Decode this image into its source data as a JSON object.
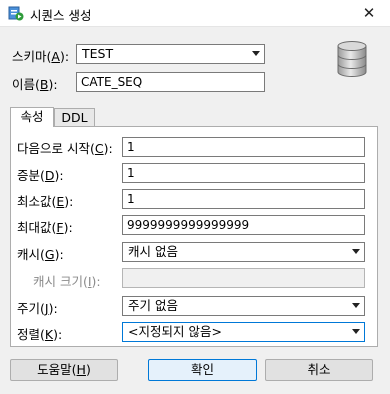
{
  "window": {
    "title": "시퀀스 생성",
    "close_glyph": "✕",
    "icon": "sequence-app-icon"
  },
  "schema": {
    "label": "스키마(",
    "mnemonic": "A",
    "suffix": "):",
    "value": "TEST"
  },
  "name": {
    "label": "이름(",
    "mnemonic": "B",
    "suffix": "):",
    "value": "CATE_SEQ"
  },
  "tabs": [
    {
      "label": "속성",
      "active": true
    },
    {
      "label": "DDL",
      "active": false
    }
  ],
  "properties": {
    "start_with": {
      "label": "다음으로 시작(",
      "mnemonic": "C",
      "suffix": "):",
      "value": "1"
    },
    "increment": {
      "label": "증분(",
      "mnemonic": "D",
      "suffix": "):",
      "value": "1"
    },
    "min_value": {
      "label": "최소값(",
      "mnemonic": "E",
      "suffix": "):",
      "value": "1"
    },
    "max_value": {
      "label": "최대값(",
      "mnemonic": "F",
      "suffix": "):",
      "value": "9999999999999999"
    },
    "cache": {
      "label": "캐시(",
      "mnemonic": "G",
      "suffix": "):",
      "value": "캐시 없음"
    },
    "cache_size": {
      "label": "캐시 크기(",
      "mnemonic": "I",
      "suffix": "):",
      "value": ""
    },
    "cycle": {
      "label": "주기(",
      "mnemonic": "J",
      "suffix": "):",
      "value": "주기 없음"
    },
    "order": {
      "label": "정렬(",
      "mnemonic": "K",
      "suffix": "):",
      "value": "<지정되지 않음>"
    }
  },
  "buttons": {
    "help": {
      "label": "도움말(",
      "mnemonic": "H",
      "suffix": ")"
    },
    "ok": {
      "label": "확인"
    },
    "cancel": {
      "label": "취소"
    }
  },
  "colors": {
    "focus_border": "#0078d7",
    "background": "#f0f0f0"
  }
}
